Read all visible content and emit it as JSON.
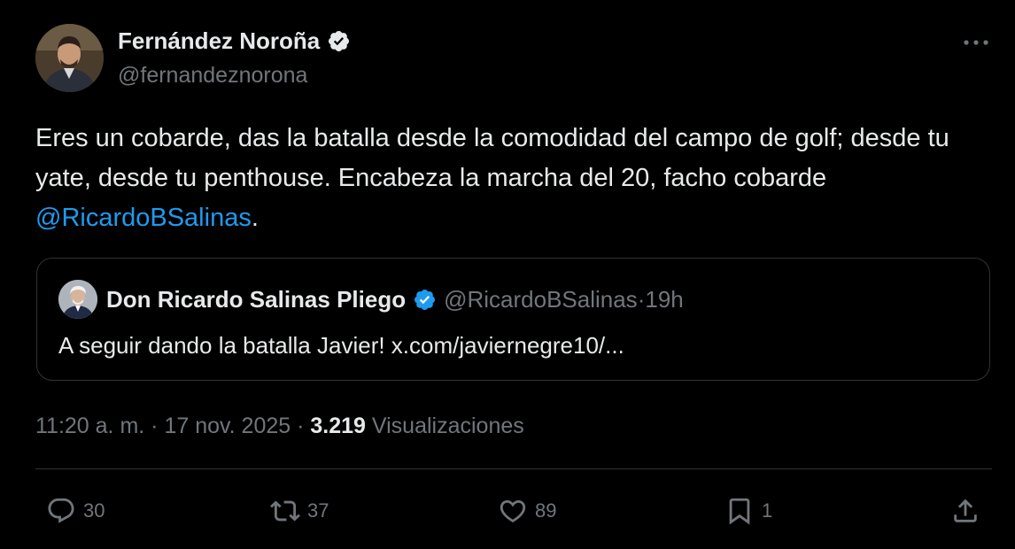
{
  "author": {
    "display_name": "Fernández Noroña",
    "handle": "@fernandeznorona",
    "verified": true
  },
  "tweet": {
    "text_main": "Eres un cobarde, das la batalla desde la comodidad del campo de golf; desde tu yate, desde tu penthouse. Encabeza la marcha del 20, facho cobarde ",
    "mention": "@RicardoBSalinas",
    "text_end": "."
  },
  "quote": {
    "display_name": "Don Ricardo Salinas Pliego",
    "handle": "@RicardoBSalinas",
    "separator": " · ",
    "time": "19h",
    "text": "A seguir dando la batalla Javier! x.com/javiernegre10/..."
  },
  "meta": {
    "time": "11:20 a. m.",
    "separator": " · ",
    "date": "17 nov. 2025",
    "separator2": " · ",
    "views_count": "3.219",
    "views_label": " Visualizaciones"
  },
  "actions": {
    "replies": "30",
    "reposts": "37",
    "likes": "89",
    "bookmarks": "1"
  },
  "icons": {
    "more": "more-dots-icon",
    "verified": "verified-badge-icon",
    "reply": "reply-icon",
    "repost": "repost-icon",
    "like": "heart-icon",
    "bookmark": "bookmark-icon",
    "share": "share-icon"
  },
  "colors": {
    "background": "#000000",
    "text": "#e7e9ea",
    "muted": "#71767b",
    "accent": "#1d9bf0",
    "border": "#2f3336"
  }
}
